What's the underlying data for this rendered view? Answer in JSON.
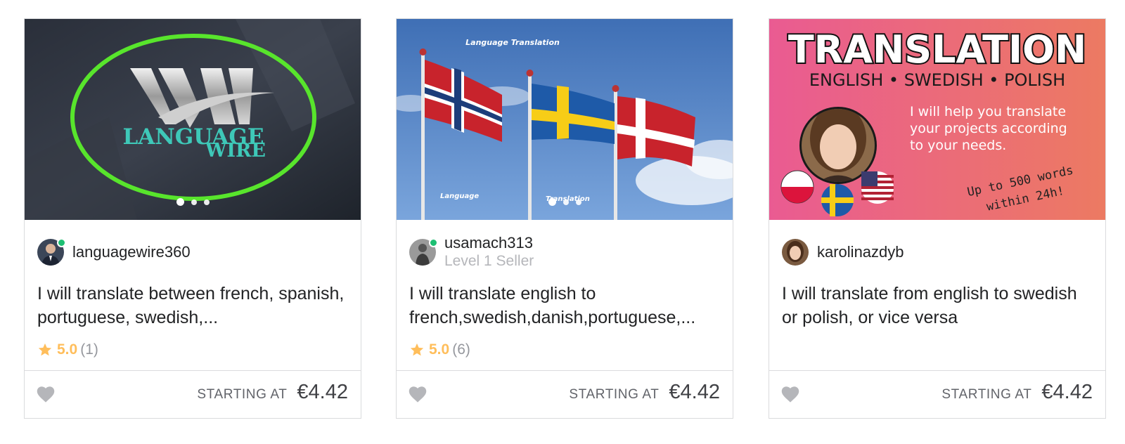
{
  "gigs": [
    {
      "seller": "languagewire360",
      "seller_level": "",
      "title": "I will translate between french, spanish, portuguese, swedish,...",
      "rating": "5.0",
      "reviews": "(1)",
      "starting_label": "STARTING AT",
      "price": "€4.42",
      "thumbnail_text": [
        "LANGUAGE",
        "WIRE"
      ]
    },
    {
      "seller": "usamach313",
      "seller_level": "Level 1 Seller",
      "title": "I will translate english to french,swedish,danish,portuguese,...",
      "rating": "5.0",
      "reviews": "(6)",
      "starting_label": "STARTING AT",
      "price": "€4.42",
      "thumbnail_text": [
        "Language Translation",
        "Language",
        "Translation"
      ]
    },
    {
      "seller": "karolinazdyb",
      "seller_level": "",
      "title": "I will translate from english to swedish or polish, or vice versa",
      "rating": "",
      "reviews": "",
      "starting_label": "STARTING AT",
      "price": "€4.42",
      "thumbnail_text": [
        "TRANSLATION",
        "ENGLISH • SWEDISH • POLISH",
        "I will help you translate",
        "your projects according",
        "to your needs.",
        "Up to 500 words",
        "within 24h!"
      ]
    }
  ],
  "colors": {
    "online": "#1dbf73",
    "star": "#ffbe5b",
    "border": "#dadbdd",
    "heart": "#b5b6ba"
  },
  "icons": {
    "star": "star-icon",
    "heart": "heart-icon"
  }
}
